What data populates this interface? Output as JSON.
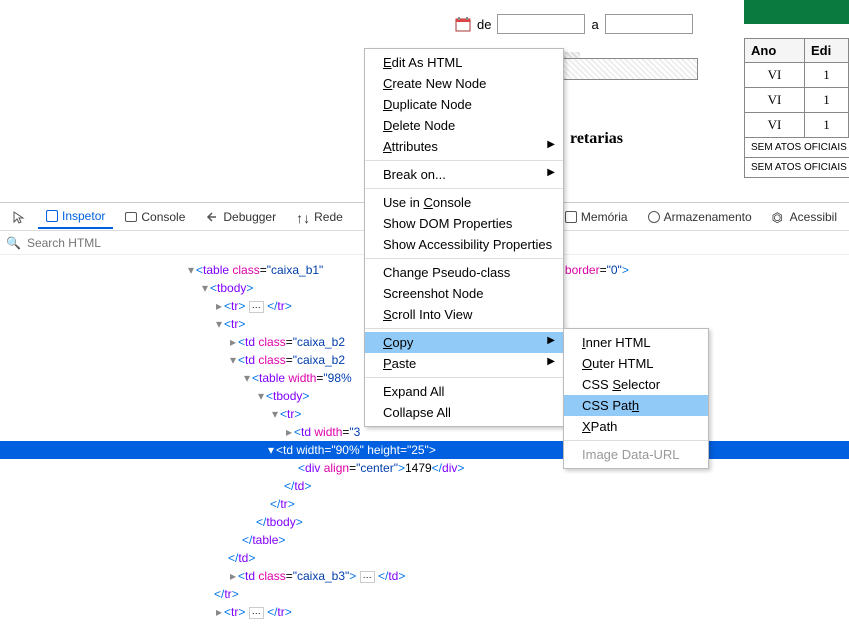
{
  "date_filter": {
    "de": "de",
    "a": "a"
  },
  "heading_partial": "retarias",
  "side_table": {
    "headers": [
      "Ano",
      "Edi"
    ],
    "rows": [
      {
        "ano": "VI",
        "edi": "1"
      },
      {
        "ano": "VI",
        "edi": "1"
      },
      {
        "ano": "VI",
        "edi": "1"
      }
    ],
    "textrows": [
      "SEM ATOS OFICIAIS NE",
      "SEM ATOS OFICIAIS NE"
    ]
  },
  "toolbar": {
    "inspetor": "Inspetor",
    "console": "Console",
    "debugger": "Debugger",
    "rede": "Rede",
    "memoria": "Memória",
    "armazenamento": "Armazenamento",
    "acessibilidade": "Acessibil"
  },
  "search_placeholder": "Search HTML",
  "dom": {
    "line_table": "<table class=\"caixa_b1\" ",
    "line_table_attrs": "ding=\"0\" border=\"0\">",
    "tbody_open": "<tbody>",
    "tr_ellipsis": "<tr>",
    "tr_ellipsis_close": "</tr>",
    "tr_open": "<tr>",
    "td_b2a": "<td class=\"caixa_b2",
    "td_b2b": "<td class=\"caixa_b2",
    "table_98": "<table width=\"98%",
    "tbody2": "<tbody>",
    "tr2": "<tr>",
    "td_width3": "<td width=\"3",
    "td_selected": "<td width=\"90%\" height=\"25\">",
    "div_center": "<div align=\"center\">",
    "div_val": "1479",
    "div_close": "</div>",
    "td_close": "</td>",
    "tr_close": "</tr>",
    "tbody_close": "</tbody>",
    "table_close": "</table>",
    "td_b3": "<td class=\"caixa_b3\">",
    "td_b3_close": "</td>"
  },
  "context_menu": {
    "edit_html": "Edit As HTML",
    "create_node": "Create New Node",
    "duplicate": "Duplicate Node",
    "delete": "Delete Node",
    "attributes": "Attributes",
    "break_on": "Break on...",
    "use_console": "Use in Console",
    "show_dom": "Show DOM Properties",
    "show_access": "Show Accessibility Properties",
    "change_pseudo": "Change Pseudo-class",
    "screenshot": "Screenshot Node",
    "scroll_into": "Scroll Into View",
    "copy": "Copy",
    "paste": "Paste",
    "expand_all": "Expand All",
    "collapse_all": "Collapse All"
  },
  "copy_submenu": {
    "inner": "Inner HTML",
    "outer": "Outer HTML",
    "css_selector": "CSS Selector",
    "css_path": "CSS Path",
    "xpath": "XPath",
    "image_data": "Image Data-URL"
  }
}
